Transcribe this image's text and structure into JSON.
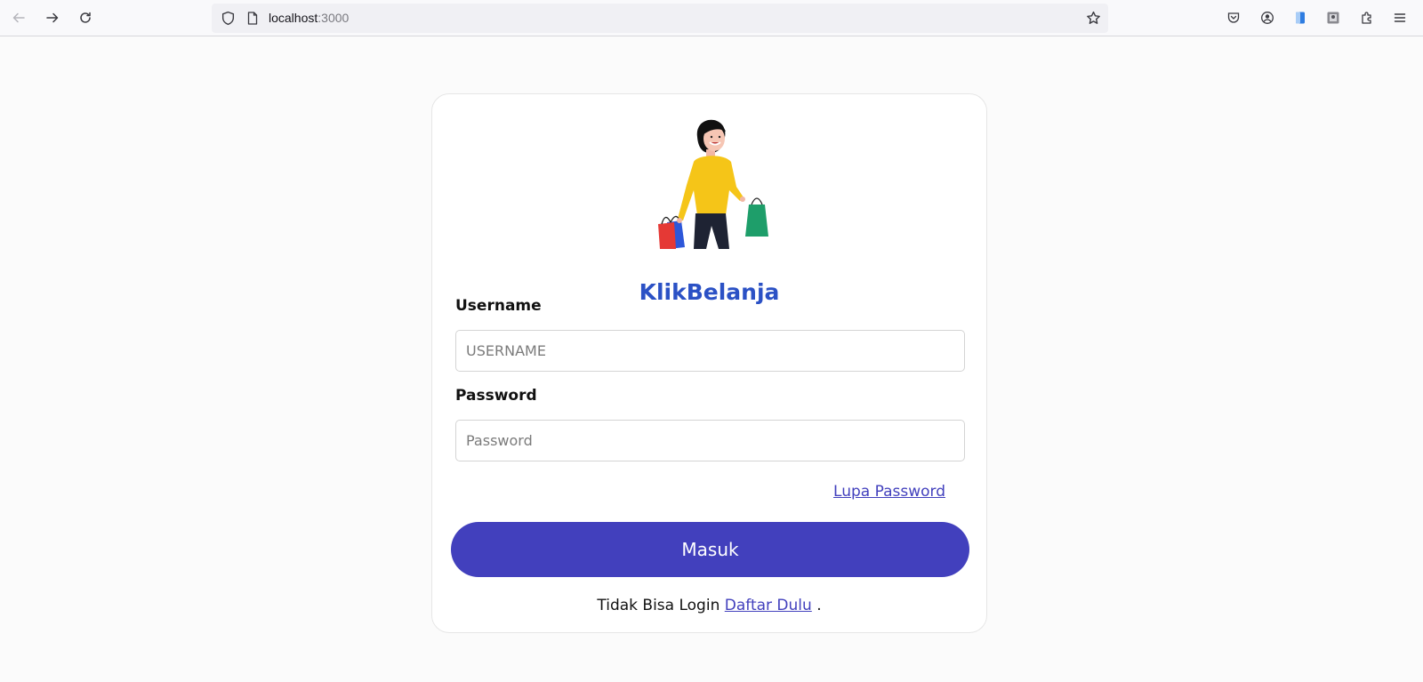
{
  "browser": {
    "url_host": "localhost",
    "url_port": ":3000",
    "icons": [
      "back-icon",
      "forward-icon",
      "reload-icon",
      "shield-icon",
      "page-icon",
      "bookmark-star-icon",
      "pocket-icon",
      "account-icon",
      "extension-blue-icon",
      "extension-image-icon",
      "extensions-puzzle-icon",
      "menu-icon"
    ]
  },
  "login": {
    "brand": "KlikBelanja",
    "username_label": "Username",
    "username_placeholder": "USERNAME",
    "username_value": "",
    "password_label": "Password",
    "password_placeholder": "Password",
    "password_value": "",
    "forgot_link": "Lupa Password",
    "submit_label": "Masuk",
    "register_prefix": "Tidak Bisa Login ",
    "register_link": "Daftar Dulu",
    "register_suffix": " ."
  },
  "colors": {
    "brand": "#2b51c5",
    "primary_button": "#4240bd",
    "link": "#4240bd",
    "page_bg": "#fbfbfb"
  }
}
